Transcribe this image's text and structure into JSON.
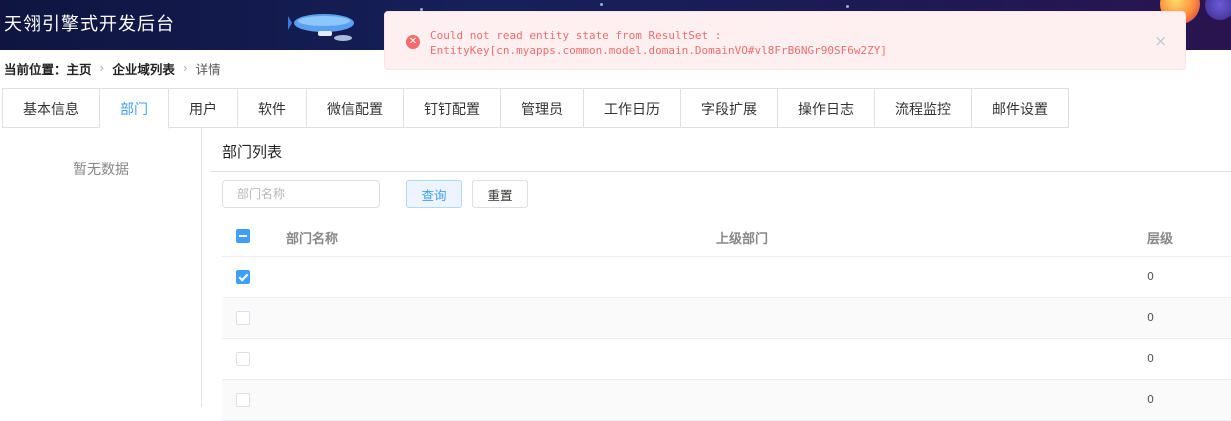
{
  "header": {
    "title": "天翎引擎式开发后台"
  },
  "breadcrumb": {
    "prefix": "当前位置：",
    "items": [
      "主页",
      "企业域列表",
      "详情"
    ]
  },
  "toast": {
    "type": "error",
    "message": "Could not read entity state from ResultSet :\nEntityKey[cn.myapps.common.model.domain.DomainVO#vl8FrB6NGr90SF6w2ZY]",
    "close_icon": "×"
  },
  "tabs": [
    {
      "label": "基本信息",
      "active": false
    },
    {
      "label": "部门",
      "active": true
    },
    {
      "label": "用户",
      "active": false
    },
    {
      "label": "软件",
      "active": false
    },
    {
      "label": "微信配置",
      "active": false
    },
    {
      "label": "钉钉配置",
      "active": false
    },
    {
      "label": "管理员",
      "active": false
    },
    {
      "label": "工作日历",
      "active": false
    },
    {
      "label": "字段扩展",
      "active": false
    },
    {
      "label": "操作日志",
      "active": false
    },
    {
      "label": "流程监控",
      "active": false
    },
    {
      "label": "邮件设置",
      "active": false
    }
  ],
  "left_panel": {
    "empty_text": "暂无数据"
  },
  "main": {
    "title": "部门列表",
    "search": {
      "placeholder": "部门名称",
      "value": ""
    },
    "query_label": "查询",
    "reset_label": "重置"
  },
  "table": {
    "columns": [
      "部门名称",
      "上级部门",
      "层级"
    ],
    "header_checkbox": "indeterminate",
    "rows": [
      {
        "checked": true,
        "name": "",
        "parent": "",
        "level": "0"
      },
      {
        "checked": false,
        "name": "",
        "parent": "",
        "level": "0"
      },
      {
        "checked": false,
        "name": "",
        "parent": "",
        "level": "0"
      },
      {
        "checked": false,
        "name": "",
        "parent": "",
        "level": "0"
      }
    ]
  },
  "colors": {
    "accent": "#409eff",
    "error": "#f56c6c",
    "header_bg": "#16205a"
  }
}
